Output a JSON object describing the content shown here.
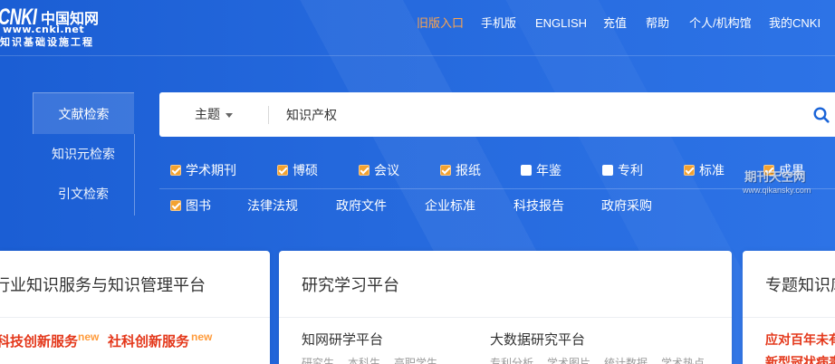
{
  "logo": {
    "brand": "CNKI",
    "name_cn": "中国知网",
    "url": "www.cnki.net",
    "tagline": "知识基础设施工程"
  },
  "nav": [
    {
      "label": "旧版入口"
    },
    {
      "label": "手机版"
    },
    {
      "label": "ENGLISH"
    },
    {
      "label": "充值"
    },
    {
      "label": "帮助"
    },
    {
      "label": "个人/机构馆"
    },
    {
      "label": "我的CNKI"
    }
  ],
  "search_tabs": [
    {
      "label": "文献检索",
      "selected": true
    },
    {
      "label": "知识元检索",
      "selected": false
    },
    {
      "label": "引文检索",
      "selected": false
    }
  ],
  "search": {
    "field": "主题",
    "query": "知识产权"
  },
  "icons": {
    "search": "search-icon",
    "field_dropdown": "caret-down-icon"
  },
  "sources": {
    "row1": [
      {
        "label": "学术期刊",
        "checked": true
      },
      {
        "label": "博硕",
        "checked": true
      },
      {
        "label": "会议",
        "checked": true
      },
      {
        "label": "报纸",
        "checked": true
      },
      {
        "label": "年鉴",
        "checked": false
      },
      {
        "label": "专利",
        "checked": false
      },
      {
        "label": "标准",
        "checked": true
      },
      {
        "label": "成果",
        "checked": true
      }
    ],
    "row2": [
      {
        "label": "图书",
        "checked": true
      },
      {
        "label": "法律法规"
      },
      {
        "label": "政府文件"
      },
      {
        "label": "企业标准"
      },
      {
        "label": "科技报告"
      },
      {
        "label": "政府采购"
      }
    ]
  },
  "watermark": {
    "name": "期刊天空网",
    "url": "www.qikansky.com"
  },
  "cards": {
    "industry": {
      "title": "行业知识服务与知识管理平台",
      "services": [
        {
          "label": "科技创新服务",
          "badge": "new"
        },
        {
          "label": "社科创新服务",
          "badge": "new"
        }
      ]
    },
    "research": {
      "title": "研究学习平台",
      "platforms": [
        {
          "label": "知网研学平台",
          "tags": [
            "研究生",
            "本科生",
            "高职学生"
          ]
        },
        {
          "label": "大数据研究平台",
          "tags": [
            "专利分析",
            "学术图片",
            "统计数据",
            "学术热点"
          ]
        }
      ]
    },
    "topics": {
      "title": "专题知识库",
      "items": [
        "应对百年未有",
        "新型冠状病毒"
      ]
    }
  },
  "colors": {
    "background": "#2468dc",
    "accent_orange": "#ffa54c",
    "checkbox_checked": "#f3a230",
    "service_red": "#e4381b",
    "badge_orange": "#ff9b3b",
    "search_icon": "#1a64d8"
  }
}
